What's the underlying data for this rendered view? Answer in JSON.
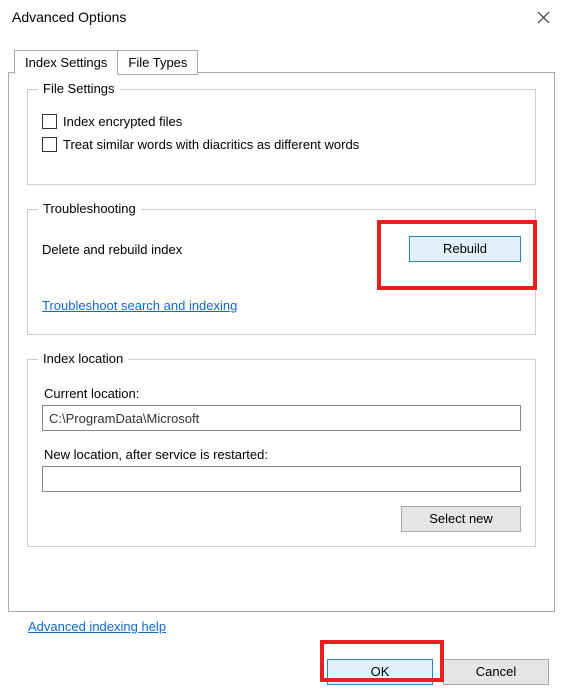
{
  "title": "Advanced Options",
  "tabs": {
    "index_settings": "Index Settings",
    "file_types": "File Types"
  },
  "file_settings": {
    "legend": "File Settings",
    "opt_encrypted": "Index encrypted files",
    "opt_diacritics": "Treat similar words with diacritics as different words"
  },
  "troubleshooting": {
    "legend": "Troubleshooting",
    "delete_rebuild": "Delete and rebuild index",
    "rebuild_btn": "Rebuild",
    "ts_link": "Troubleshoot search and indexing"
  },
  "index_location": {
    "legend": "Index location",
    "current_label": "Current location:",
    "current_value": "C:\\ProgramData\\Microsoft",
    "new_label": "New location, after service is restarted:",
    "new_value": "",
    "select_new_btn": "Select new"
  },
  "footer": {
    "help_link": "Advanced indexing help"
  },
  "buttons": {
    "ok": "OK",
    "cancel": "Cancel"
  }
}
